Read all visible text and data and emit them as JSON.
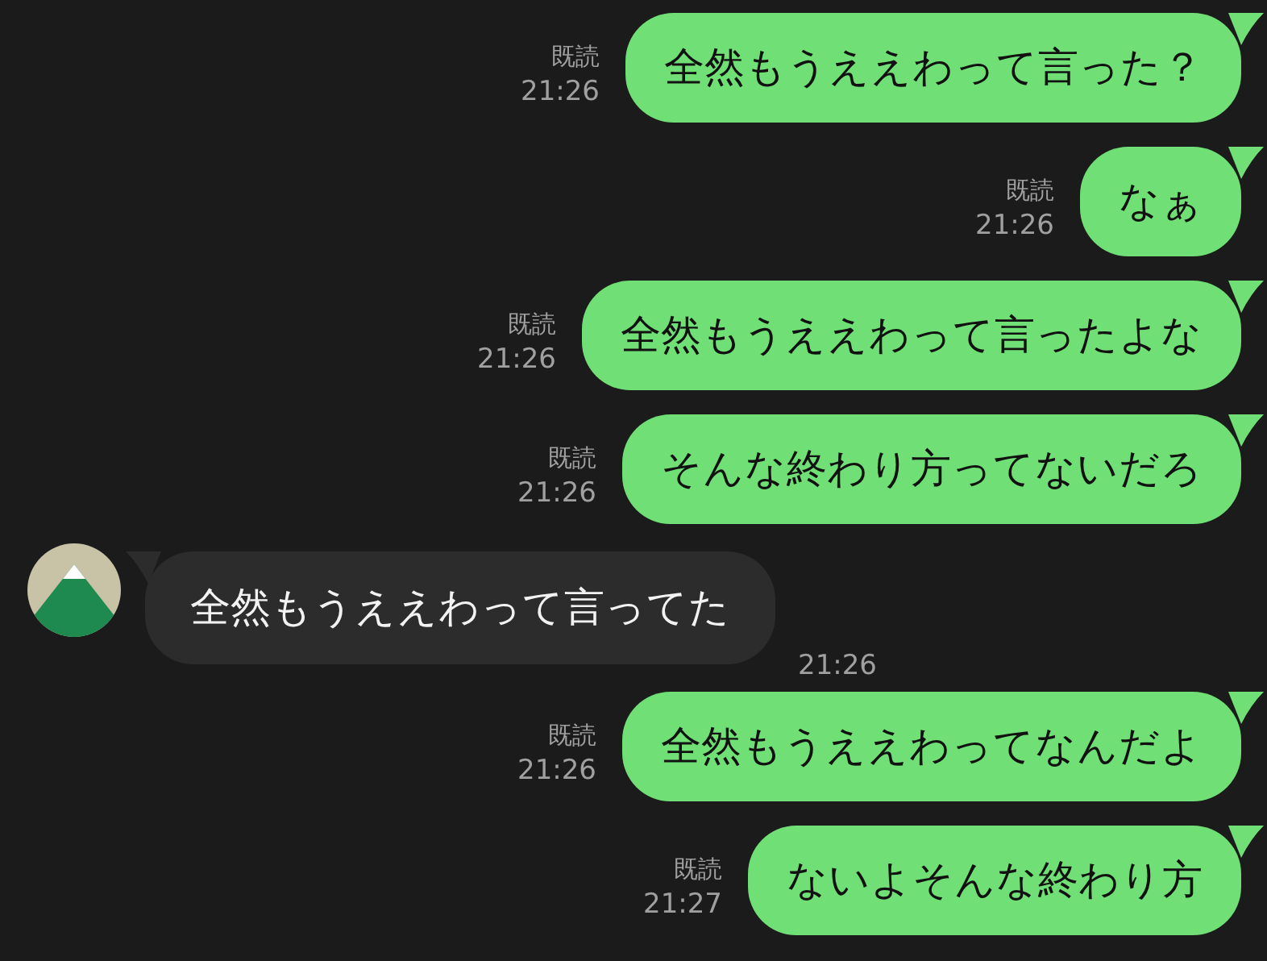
{
  "messages": [
    {
      "kind": "sent",
      "text": "全然もうええわって言った？",
      "read": "既読",
      "time": "21:26"
    },
    {
      "kind": "sent",
      "text": "なぁ",
      "read": "既読",
      "time": "21:26"
    },
    {
      "kind": "sent",
      "text": "全然もうええわって言ったよな",
      "read": "既読",
      "time": "21:26"
    },
    {
      "kind": "sent",
      "text": "そんな終わり方ってないだろ",
      "read": "既読",
      "time": "21:26"
    },
    {
      "kind": "received",
      "text": "全然もうええわって言ってた",
      "time": "21:26"
    },
    {
      "kind": "sent",
      "text": "全然もうええわってなんだよ",
      "read": "既読",
      "time": "21:26"
    },
    {
      "kind": "sent",
      "text": "ないよそんな終わり方",
      "read": "既読",
      "time": "21:27"
    }
  ]
}
